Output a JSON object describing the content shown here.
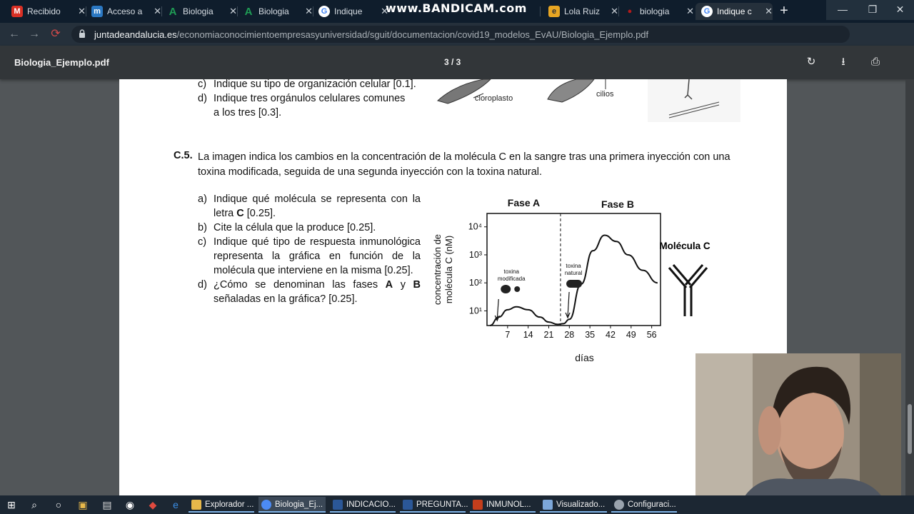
{
  "browser": {
    "tabs": [
      {
        "label": "Recibido",
        "favicon": "gmail-icon",
        "color": "#d93025"
      },
      {
        "label": "Acceso a",
        "favicon": "moodle-icon",
        "color": "#2b78c2"
      },
      {
        "label": "Biologia",
        "favicon": "andalucia-icon",
        "color": "#1f9d55"
      },
      {
        "label": "Biologia",
        "favicon": "andalucia-icon",
        "color": "#1f9d55"
      },
      {
        "label": "Indique",
        "favicon": "google-icon",
        "color": "#ffffff"
      },
      {
        "label": "",
        "favicon": "",
        "color": ""
      },
      {
        "label": "Lola Ruiz",
        "favicon": "web-icon",
        "color": "#e8a623"
      },
      {
        "label": "biologia",
        "favicon": "web-icon",
        "color": "#b31b1b"
      },
      {
        "label": "Indique c",
        "favicon": "google-icon",
        "color": "#ffffff"
      }
    ],
    "recording_watermark": "www.BANDICAM.com",
    "address": {
      "domain": "juntadeandalucia.es",
      "path": "/economiaconocimientoempresasyuniversidad/sguit/documentacion/covid19_modelos_EvAU/Biologia_Ejemplo.pdf"
    }
  },
  "pdf": {
    "title": "Biologia_Ejemplo.pdf",
    "page_indicator": "3 / 3",
    "prev_question": {
      "items": [
        {
          "label": "c)",
          "text": "Indique su tipo de organización celular [0.1]."
        },
        {
          "label": "d)",
          "text": "Indique tres orgánulos celulares comunes a los tres [0.3]."
        }
      ],
      "image_labels": {
        "left": "cloroplasto",
        "right": "cilios"
      }
    },
    "question": {
      "number": "C.5.",
      "statement": "La imagen indica los cambios en la concentración de la molécula C en la sangre tras una primera inyección con una toxina modificada, seguida de una segunda inyección con la toxina natural.",
      "items": [
        {
          "label": "a)",
          "text_before": "Indique qué molécula se representa con la letra ",
          "bold": "C",
          "text_after": " [0.25]."
        },
        {
          "label": "b)",
          "text_before": "Cite la célula que la produce [0.25].",
          "bold": "",
          "text_after": ""
        },
        {
          "label": "c)",
          "text_before": "Indique qué tipo de respuesta inmunológica representa la gráfica en función de la molécula que interviene en la misma [0.25].",
          "bold": "",
          "text_after": ""
        },
        {
          "label": "d)",
          "text_before": "¿Cómo se denominan las fases ",
          "bold": "A",
          "text_mid": " y ",
          "bold2": "B",
          "text_after": " señaladas en la gráfica? [0.25]."
        }
      ]
    },
    "figure": {
      "phase_a": "Fase A",
      "phase_b": "Fase B",
      "ylabel_line1": "concentración de",
      "ylabel_line2": "molécula C (nM)",
      "xlabel": "días",
      "annotation_1_line1": "toxina",
      "annotation_1_line2": "modificada",
      "annotation_2_line1": "toxina",
      "annotation_2_line2": "natural",
      "molecule_label": "Molécula C"
    }
  },
  "chart_data": {
    "type": "line",
    "title": "",
    "xlabel": "días",
    "ylabel": "concentración de molécula C (nM)",
    "x_ticks": [
      7,
      14,
      21,
      28,
      35,
      42,
      49,
      56
    ],
    "y_ticks": [
      "10¹",
      "10²",
      "10³",
      "10⁴"
    ],
    "y_scale": "log",
    "xlim": [
      0,
      59
    ],
    "ylim": [
      3,
      30000
    ],
    "series": [
      {
        "x": [
          1,
          4,
          7,
          10,
          14,
          18,
          21,
          24,
          26,
          28,
          32,
          36,
          40,
          44,
          48,
          53,
          58
        ],
        "y": [
          3,
          6,
          11,
          14,
          11,
          6,
          4,
          3.3,
          3.5,
          5,
          90,
          1400,
          5000,
          3000,
          1000,
          280,
          100
        ]
      }
    ],
    "annotations": [
      {
        "text": "toxina modificada",
        "x": 2
      },
      {
        "text": "toxina natural",
        "x": 26
      }
    ],
    "phase_divider_x": 25,
    "grid": false
  },
  "taskbar": {
    "items": [
      {
        "label": "Explorador ...",
        "color": "#e8b84a"
      },
      {
        "label": "Biologia_Ej...",
        "color": "#4c8bf5"
      },
      {
        "label": "INDICACIO...",
        "color": "#2b5797"
      },
      {
        "label": "PREGUNTA...",
        "color": "#2b5797"
      },
      {
        "label": "INMUNOL...",
        "color": "#c43e1c"
      },
      {
        "label": "Visualizado...",
        "color": "#7da7d9"
      },
      {
        "label": "Configuraci...",
        "color": "#9aa3ad"
      }
    ]
  }
}
